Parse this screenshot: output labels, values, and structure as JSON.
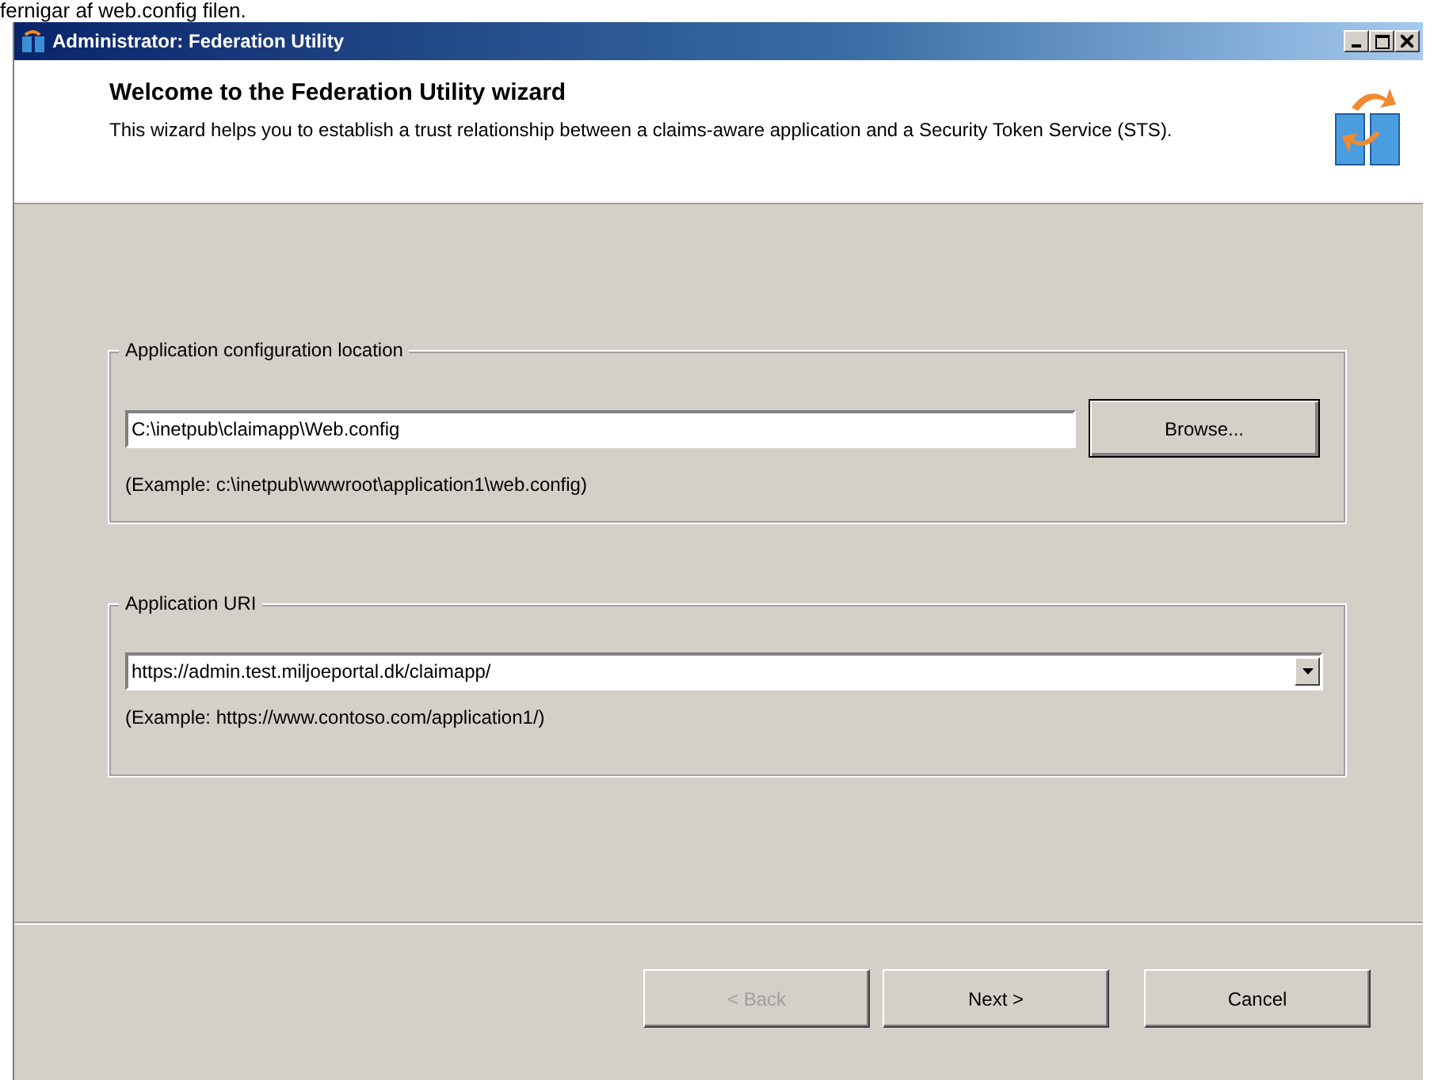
{
  "caption": "fernigar af web.config filen.",
  "window": {
    "title": "Administrator: Federation Utility"
  },
  "header": {
    "heading": "Welcome to the Federation Utility wizard",
    "description": "This wizard helps you to establish a trust relationship between a claims-aware application and a Security Token Service (STS)."
  },
  "groups": [
    {
      "label": "Application configuration location",
      "kind": "file",
      "value": "C:\\inetpub\\claimapp\\Web.config",
      "button": "Browse...",
      "example": "(Example: c:\\inetpub\\wwwroot\\application1\\web.config)"
    },
    {
      "label": "Application URI",
      "kind": "combo",
      "value": "https://admin.test.miljoeportal.dk/claimapp/",
      "example": "(Example: https://www.contoso.com/application1/)"
    }
  ],
  "buttons": [
    {
      "label": "< Back",
      "disabled": true
    },
    {
      "label": "Next >",
      "disabled": false
    },
    {
      "label": "Cancel",
      "disabled": false
    }
  ]
}
